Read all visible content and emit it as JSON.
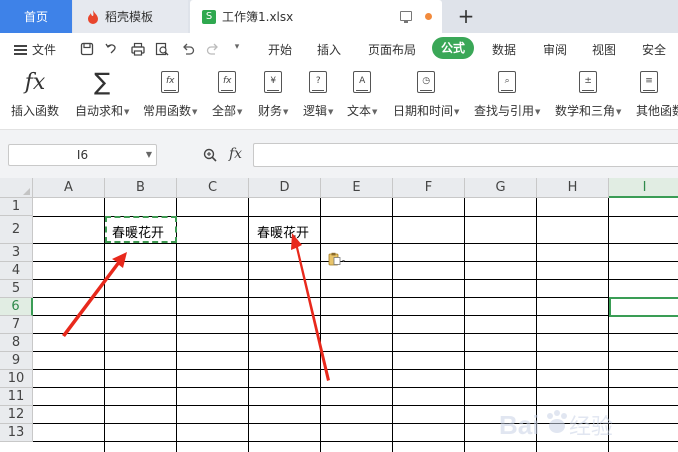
{
  "tabs": {
    "home": "首页",
    "templates": "稻壳模板",
    "document": "工作簿1.xlsx",
    "new_tab": "+"
  },
  "menu": {
    "file": "文件",
    "items": [
      "开始",
      "插入",
      "页面布局",
      "公式",
      "数据",
      "审阅",
      "视图",
      "安全"
    ],
    "active": "公式"
  },
  "ribbon": {
    "items": [
      {
        "label": "插入函数",
        "icon": "fx-icon",
        "dropdown": false
      },
      {
        "label": "自动求和",
        "icon": "sigma-icon",
        "dropdown": true
      },
      {
        "label": "常用函数",
        "icon": "fx-book-icon",
        "dropdown": true
      },
      {
        "label": "全部",
        "icon": "fx-book-icon",
        "dropdown": true
      },
      {
        "label": "财务",
        "icon": "yen-book-icon",
        "dropdown": true
      },
      {
        "label": "逻辑",
        "icon": "question-book-icon",
        "dropdown": true
      },
      {
        "label": "文本",
        "icon": "a-book-icon",
        "dropdown": true
      },
      {
        "label": "日期和时间",
        "icon": "clock-book-icon",
        "dropdown": true
      },
      {
        "label": "查找与引用",
        "icon": "search-book-icon",
        "dropdown": true
      },
      {
        "label": "数学和三角",
        "icon": "plusminus-book-icon",
        "dropdown": true
      },
      {
        "label": "其他函数",
        "icon": "book-icon",
        "dropdown": false
      }
    ]
  },
  "formula_bar": {
    "name_box": "I6",
    "fx": "fx",
    "formula": ""
  },
  "grid": {
    "columns": [
      "A",
      "B",
      "C",
      "D",
      "E",
      "F",
      "G",
      "H",
      "I"
    ],
    "rows": [
      "1",
      "2",
      "3",
      "4",
      "5",
      "6",
      "7",
      "8",
      "9",
      "10",
      "11",
      "12",
      "13"
    ],
    "selected_cell": "I6",
    "copied_cell": "B2",
    "cells": {
      "B2": "春暖花开",
      "D2": "春暖花开"
    }
  },
  "colors": {
    "accent_green": "#3aa757",
    "home_tab_blue": "#3e82e8",
    "arrow_red": "#e8291c"
  },
  "watermark": "Baidu经验"
}
